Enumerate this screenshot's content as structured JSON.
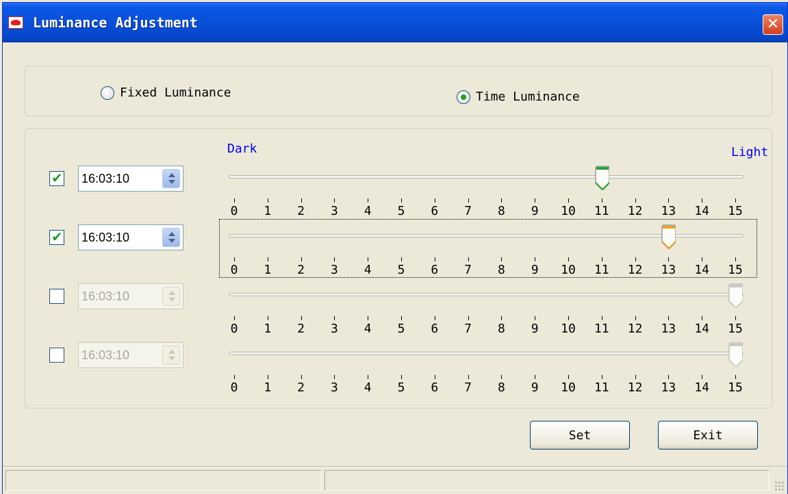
{
  "window": {
    "title": "Luminance Adjustment",
    "close_icon": "close-icon"
  },
  "mode": {
    "fixed_label": "Fixed Luminance",
    "time_label": "Time Luminance",
    "selected": "time"
  },
  "scale": {
    "dark_label": "Dark",
    "light_label": "Light",
    "min": 0,
    "max": 15,
    "ticks": [
      "0",
      "1",
      "2",
      "3",
      "4",
      "5",
      "6",
      "7",
      "8",
      "9",
      "10",
      "11",
      "12",
      "13",
      "14",
      "15"
    ]
  },
  "schedules": [
    {
      "enabled": true,
      "time": "16:03:10",
      "level": 11,
      "thumb_color": "#30a030"
    },
    {
      "enabled": true,
      "time": "16:03:10",
      "level": 13,
      "thumb_color": "#f0a020"
    },
    {
      "enabled": false,
      "time": "16:03:10",
      "level": 15,
      "thumb_color": "#c8c8c8"
    },
    {
      "enabled": false,
      "time": "16:03:10",
      "level": 15,
      "thumb_color": "#c8c8c8"
    }
  ],
  "buttons": {
    "set_label": "Set",
    "exit_label": "Exit"
  },
  "status": {
    "pane1": "",
    "pane2": ""
  }
}
